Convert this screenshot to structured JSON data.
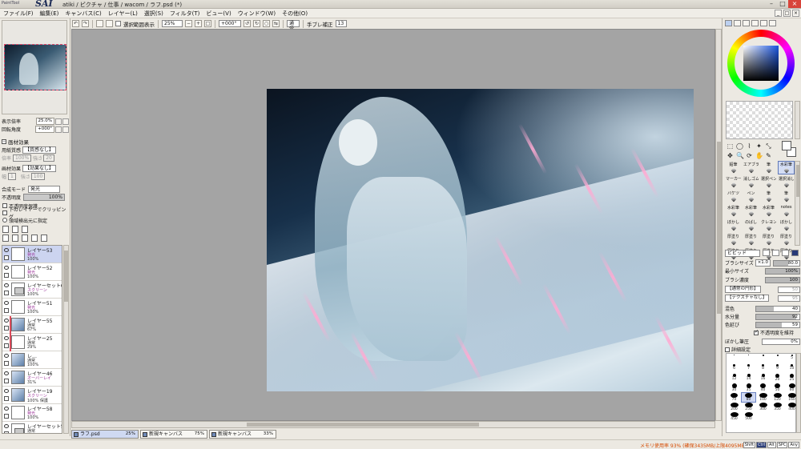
{
  "window": {
    "logo_small": "PaintTool",
    "logo_big": "SAI",
    "title": "atiki / ピクチャ / 仕事 / wacom / ラフ.psd (*)",
    "controls": [
      "–",
      "□",
      "×"
    ]
  },
  "menubar": {
    "items": [
      "ファイル(F)",
      "編集(E)",
      "キャンバス(C)",
      "レイヤー(L)",
      "選択(S)",
      "フィルタ(T)",
      "ビュー(V)",
      "ウィンドウ(W)",
      "その他(O)"
    ],
    "right_controls": [
      "_",
      "□",
      "×"
    ]
  },
  "toolbar": {
    "show_selection_label": "選択範囲表示",
    "zoom": "25%",
    "rotation": "+000°",
    "blend_mode": "通常",
    "stabilizer_label": "手ブレ補正",
    "stabilizer_value": "13"
  },
  "navigator": {
    "zoom_label": "表示倍率",
    "zoom_value": "25.0%",
    "angle_label": "回転角度",
    "angle_value": "+000°"
  },
  "paper_effect": {
    "header": "画材効果",
    "texture_label": "用紙質感",
    "texture_value": "【質感なし】",
    "texture_scale_label": "倍率",
    "texture_scale_value": "100%",
    "texture_strength_label": "強さ",
    "texture_strength_value": "20",
    "effect_label": "画材効果",
    "effect_value": "【効果なし】",
    "effect_width_label": "幅",
    "effect_width_value": "1",
    "effect_strength_label": "強さ",
    "effect_strength_value": "100"
  },
  "layer_props": {
    "blend_label": "合成モード",
    "blend_value": "発光",
    "opacity_label": "不透明度",
    "opacity_value": "100%",
    "opacity_fraction": 1.0,
    "options": [
      "不透明度保護",
      "下のレイヤーでクリッピング",
      "領域検出元に指定"
    ]
  },
  "layer_tools": {
    "row1": [
      "new-layer",
      "new-linework-layer",
      "new-folder"
    ],
    "row2": [
      "copy",
      "merge-down",
      "mask",
      "delete",
      "clear"
    ]
  },
  "layers": [
    {
      "name": "レイヤー53",
      "mode": "発光",
      "opacity": "100%",
      "selected": true,
      "kind": "blank",
      "clip": false
    },
    {
      "name": "レイヤー52",
      "mode": "発光",
      "opacity": "100%",
      "selected": false,
      "kind": "blank",
      "clip": false
    },
    {
      "name": "レイヤーセット6",
      "mode": "スクリーン",
      "opacity": "100%",
      "selected": false,
      "kind": "folder",
      "clip": false
    },
    {
      "name": "レイヤー51",
      "mode": "発光",
      "opacity": "100%",
      "selected": false,
      "kind": "blank",
      "clip": false
    },
    {
      "name": "レイヤー55",
      "mode": "通常",
      "opacity": "67%",
      "selected": false,
      "kind": "art",
      "clip": true
    },
    {
      "name": "レイヤー25",
      "mode": "通常",
      "opacity": "29%",
      "selected": false,
      "kind": "blank",
      "clip": true
    },
    {
      "name": "レ…",
      "mode": "通常",
      "opacity": "100%",
      "selected": false,
      "kind": "art",
      "clip": false
    },
    {
      "name": "レイヤー46",
      "mode": "オーバーレイ",
      "opacity": "31%",
      "selected": false,
      "kind": "art",
      "clip": false
    },
    {
      "name": "レイヤー19",
      "mode": "スクリーン",
      "opacity": "100% 保護",
      "selected": false,
      "kind": "art",
      "clip": false
    },
    {
      "name": "レイヤー58",
      "mode": "発光",
      "opacity": "100%",
      "selected": false,
      "kind": "blank",
      "clip": false
    },
    {
      "name": "レイヤーセット5",
      "mode": "通常",
      "opacity": "100%",
      "selected": false,
      "kind": "folder",
      "clip": false
    }
  ],
  "doc_tabs": [
    {
      "name": "ラフ.psd",
      "zoom": "25%",
      "active": true
    },
    {
      "name": "新規キャンバス",
      "zoom": "75%",
      "active": false
    },
    {
      "name": "新規キャンバス",
      "zoom": "33%",
      "active": false
    }
  ],
  "brushes": [
    {
      "name": "鉛筆"
    },
    {
      "name": "エアブラシ"
    },
    {
      "name": "筆"
    },
    {
      "name": "水彩筆",
      "selected": true
    },
    {
      "name": "マーカー"
    },
    {
      "name": "消しゴム"
    },
    {
      "name": "選択ペン"
    },
    {
      "name": "選択消し"
    },
    {
      "name": "バケツ"
    },
    {
      "name": "ペン"
    },
    {
      "name": "筆"
    },
    {
      "name": "筆"
    },
    {
      "name": "水彩筆"
    },
    {
      "name": "水彩筆"
    },
    {
      "name": "水彩筆"
    },
    {
      "name": "notes"
    },
    {
      "name": "ぼかし"
    },
    {
      "name": "のばし"
    },
    {
      "name": "クレヨン"
    },
    {
      "name": "ぼかし"
    },
    {
      "name": "厚塗り"
    },
    {
      "name": "厚塗り"
    },
    {
      "name": "厚塗り"
    },
    {
      "name": "厚塗り"
    },
    {
      "name": "厚塗り"
    },
    {
      "name": "厚塗り"
    },
    {
      "name": "厚塗り"
    },
    {
      "name": "厚塗り"
    }
  ],
  "brush_settings": {
    "mode": "ビビッド",
    "size_label": "ブラシサイズ",
    "size_mult": "×1.0",
    "size_value": "80.0",
    "min_size_label": "最小サイズ",
    "min_size_value": "100%",
    "density_label": "ブラシ濃度",
    "density_value": "100",
    "shape_value": "【通常の円形】",
    "texture_value": "【テクスチャなし】",
    "shape_strength": "50",
    "texture_strength": "95",
    "mix_label": "混色",
    "mix_value": "40",
    "water_label": "水分量",
    "water_value": "92",
    "persistence_label": "色延び",
    "persistence_value": "59",
    "keep_opacity_label": "不透明度を維持",
    "blur_label": "ぼかし筆圧",
    "blur_value": "0%",
    "detail_label": "詳細設定"
  },
  "sizes": [
    "1",
    "2",
    "3",
    "4",
    "5",
    "6",
    "7",
    "8",
    "9",
    "10",
    "12",
    "14",
    "16",
    "20",
    "25",
    "30",
    "35",
    "40",
    "50",
    "60",
    "70",
    "80",
    "100",
    "120",
    "160",
    "200",
    "250",
    "300",
    "350",
    "400",
    "450",
    "500"
  ],
  "selected_size": "80",
  "tool_icons": [
    "⬚",
    "◯",
    "⌇",
    "✦",
    "⤡",
    "✥",
    "🔍",
    "⟳",
    "✋",
    "✎"
  ],
  "status": {
    "memory": "メモリ使用率 93% (確保3435MB/上限4095MB)",
    "keys": [
      "Shift",
      "Ctrl",
      "Alt",
      "SPC",
      "Any"
    ]
  }
}
